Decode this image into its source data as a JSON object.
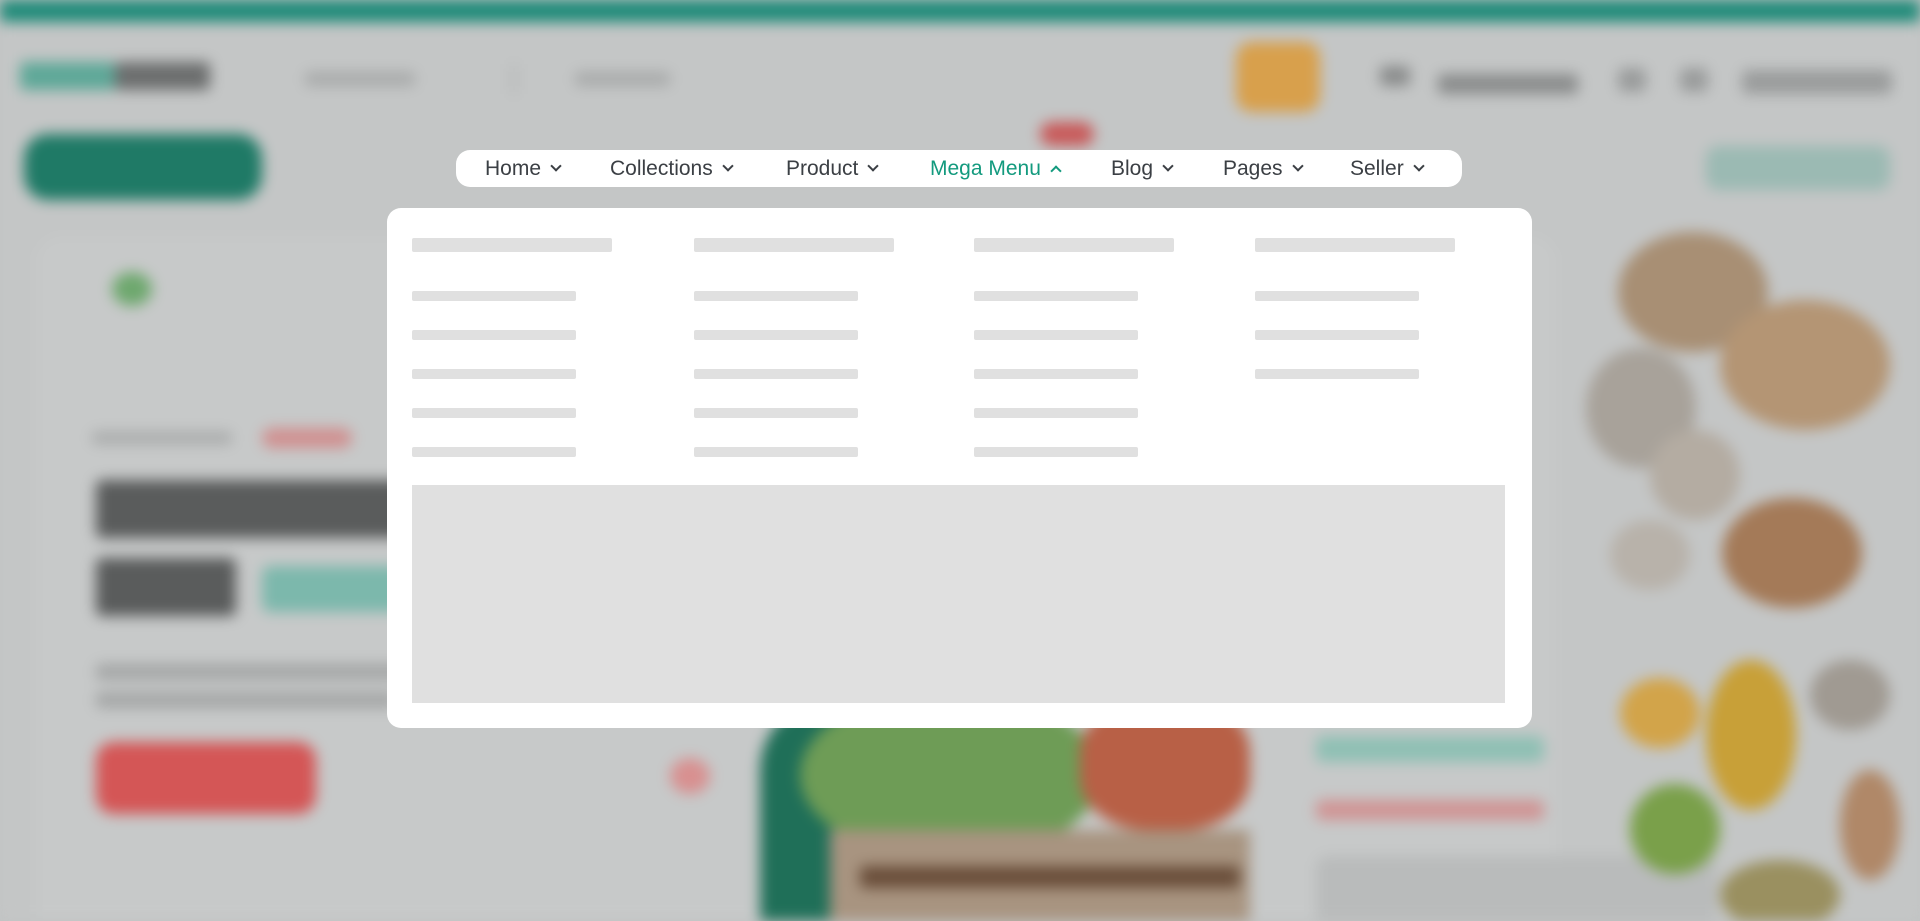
{
  "nav": {
    "items": [
      {
        "label": "Home"
      },
      {
        "label": "Collections"
      },
      {
        "label": "Product"
      },
      {
        "label": "Mega Menu",
        "active": true
      },
      {
        "label": "Blog"
      },
      {
        "label": "Pages"
      },
      {
        "label": "Seller"
      }
    ]
  },
  "mega_menu": {
    "state": "loading",
    "columns": [
      {
        "link_count": 5
      },
      {
        "link_count": 5
      },
      {
        "link_count": 5
      },
      {
        "link_count": 3
      }
    ],
    "banner": "loading"
  },
  "colors": {
    "accent": "#139a7e",
    "nav_text": "#3b3f44",
    "skeleton": "#e0e0e0",
    "overlay": "#c2c4c4"
  },
  "icons": {
    "dropdown": "chevron-down-icon",
    "dropdown_open": "chevron-up-icon"
  }
}
